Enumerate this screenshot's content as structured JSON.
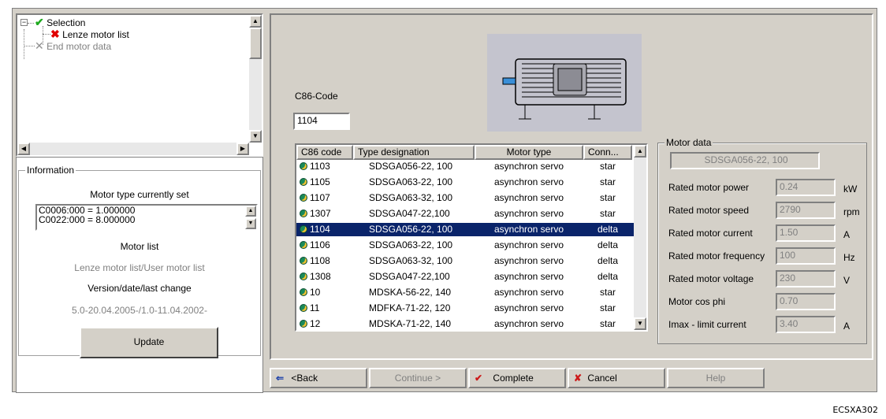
{
  "tree": {
    "items": [
      {
        "label": "Selection"
      },
      {
        "label": "Lenze motor list"
      },
      {
        "label": "End motor data"
      }
    ]
  },
  "info": {
    "group_label": "Information",
    "motor_type_title": "Motor type currently set",
    "code_lines": [
      "C0006:000 = 1.000000",
      "C0022:000 = 8.000000"
    ],
    "motor_list_title": "Motor list",
    "motor_list_value": "Lenze motor list/User motor list",
    "version_title": "Version/date/last change",
    "version_value": "5.0-20.04.2005-/1.0-11.04.2002-",
    "update_label": "Update"
  },
  "c86": {
    "label": "C86-Code",
    "value": "1104"
  },
  "table": {
    "headers": [
      "C86 code",
      "Type designation",
      "Motor type",
      "Conn..."
    ],
    "rows": [
      {
        "code": "1103",
        "type": "SDSGA056-22, 100",
        "motor": "asynchron servo",
        "conn": "star"
      },
      {
        "code": "1105",
        "type": "SDSGA063-22, 100",
        "motor": "asynchron servo",
        "conn": "star"
      },
      {
        "code": "1107",
        "type": "SDSGA063-32, 100",
        "motor": "asynchron servo",
        "conn": "star"
      },
      {
        "code": "1307",
        "type": "SDSGA047-22,100",
        "motor": "asynchron servo",
        "conn": "star"
      },
      {
        "code": "1104",
        "type": "SDSGA056-22, 100",
        "motor": "asynchron servo",
        "conn": "delta"
      },
      {
        "code": "1106",
        "type": "SDSGA063-22, 100",
        "motor": "asynchron servo",
        "conn": "delta"
      },
      {
        "code": "1108",
        "type": "SDSGA063-32, 100",
        "motor": "asynchron servo",
        "conn": "delta"
      },
      {
        "code": "1308",
        "type": "SDSGA047-22,100",
        "motor": "asynchron servo",
        "conn": "delta"
      },
      {
        "code": "10",
        "type": "MDSKA-56-22, 140",
        "motor": "asynchron servo",
        "conn": "star"
      },
      {
        "code": "11",
        "type": "MDFKA-71-22, 120",
        "motor": "asynchron servo",
        "conn": "star"
      },
      {
        "code": "12",
        "type": "MDSKA-71-22, 140",
        "motor": "asynchron servo",
        "conn": "star"
      }
    ],
    "selected_code": "1104"
  },
  "motor_data": {
    "group_label": "Motor data",
    "name": "SDSGA056-22, 100",
    "fields": [
      {
        "label": "Rated motor power",
        "value": "0.24",
        "unit": "kW"
      },
      {
        "label": "Rated motor speed",
        "value": "2790",
        "unit": "rpm"
      },
      {
        "label": "Rated motor current",
        "value": "1.50",
        "unit": "A"
      },
      {
        "label": "Rated motor frequency",
        "value": "100",
        "unit": "Hz"
      },
      {
        "label": "Rated motor voltage",
        "value": "230",
        "unit": "V"
      },
      {
        "label": "Motor cos phi",
        "value": "0.70",
        "unit": ""
      },
      {
        "label": "Imax - limit current",
        "value": "3.40",
        "unit": "A"
      }
    ]
  },
  "buttons": {
    "back": "<Back",
    "continue": "Continue >",
    "complete": "Complete",
    "cancel": "Cancel",
    "help": "Help"
  },
  "footer": "ECSXA302",
  "colors": {
    "selection": "#0a246a",
    "check": "#1faa1f",
    "cross": "#e00000",
    "dialog": "#d4d0c8"
  }
}
